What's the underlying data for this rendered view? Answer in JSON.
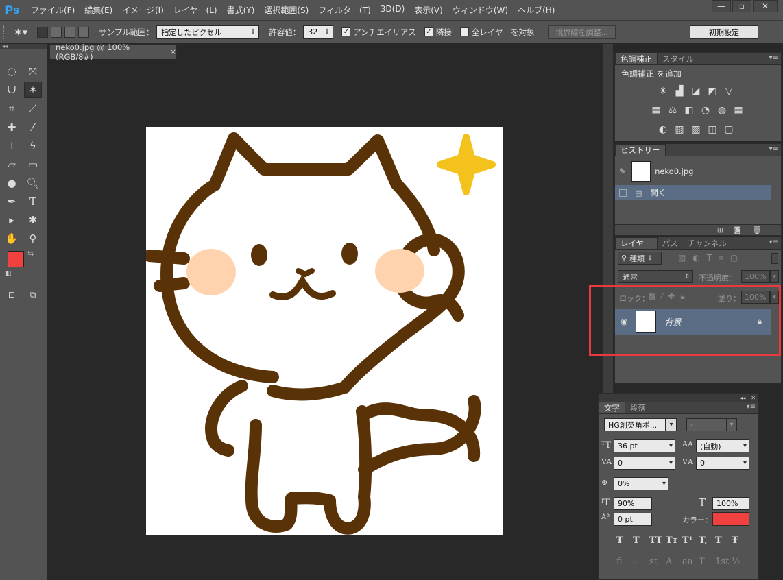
{
  "app": {
    "logo": "Ps"
  },
  "menu": [
    "ファイル(F)",
    "編集(E)",
    "イメージ(I)",
    "レイヤー(L)",
    "書式(Y)",
    "選択範囲(S)",
    "フィルター(T)",
    "3D(D)",
    "表示(V)",
    "ウィンドウ(W)",
    "ヘルプ(H)"
  ],
  "window_controls": {
    "minimize": "—",
    "restore": "▫",
    "close": "✕"
  },
  "options": {
    "sample_label": "サンプル範囲：",
    "sample_value": "指定したピクセル",
    "tolerance_label": "許容値：",
    "tolerance_value": "32",
    "antialias_label": "アンチエイリアス",
    "antialias_checked": "✓",
    "contiguous_label": "隣接",
    "contiguous_checked": "✓",
    "all_layers_label": "全レイヤーを対象",
    "refine_edge": "境界線を調整...",
    "workspace": "初期設定"
  },
  "document": {
    "tab_title": "neko0.jpg @ 100% (RGB/8#)",
    "close": "×"
  },
  "colors": {
    "foreground": "#f04040",
    "background": "#ffffff",
    "outline": "#5a3208",
    "cheek": "#ffd3ad",
    "sparkle": "#f4c21c",
    "highlight": "#e8393f"
  },
  "adjustments_panel": {
    "tabs": [
      "色調補正",
      "スタイル"
    ],
    "heading": "色調補正 を追加",
    "icons": [
      "brightness-icon",
      "levels-icon",
      "curves-icon",
      "exposure-icon",
      "vibrance-icon",
      "hue-icon",
      "color-balance-icon",
      "bw-icon",
      "photo-filter-icon",
      "channel-mixer-icon",
      "color-lookup-icon",
      "invert-icon",
      "posterize-icon",
      "threshold-icon",
      "gradient-map-icon",
      "selective-color-icon"
    ]
  },
  "history_panel": {
    "tabs": [
      "ヒストリー"
    ],
    "snapshot_label": "neko0.jpg",
    "items": [
      {
        "label": "開く"
      }
    ]
  },
  "layers_panel": {
    "tabs": [
      "レイヤー",
      "パス",
      "チャンネル"
    ],
    "filter_kind": "種類",
    "blend_mode": "通常",
    "opacity_label": "不透明度：",
    "opacity_value": "100%",
    "lock_label": "ロック：",
    "fill_label": "塗り：",
    "fill_value": "100%",
    "layers": [
      {
        "name": "背景",
        "locked": true
      }
    ]
  },
  "character_panel": {
    "tabs": [
      "文字",
      "段落"
    ],
    "font_family": "HG創英角ポ...",
    "font_style": "-",
    "size": "36 pt",
    "leading": "(自動)",
    "kerning": "0",
    "tracking": "0",
    "scale_tsume": "0%",
    "vertical_scale": "90%",
    "horizontal_scale": "100%",
    "baseline": "0 pt",
    "color_label": "カラー：",
    "color_value": "#f04040",
    "format_buttons_1": [
      "T",
      "T",
      "TT",
      "Tт",
      "T¹",
      "T,",
      "T",
      "Ŧ"
    ],
    "format_buttons_2": [
      "fi",
      "ℴ",
      "st",
      "A",
      "aa",
      "T",
      "1st",
      "½"
    ]
  }
}
